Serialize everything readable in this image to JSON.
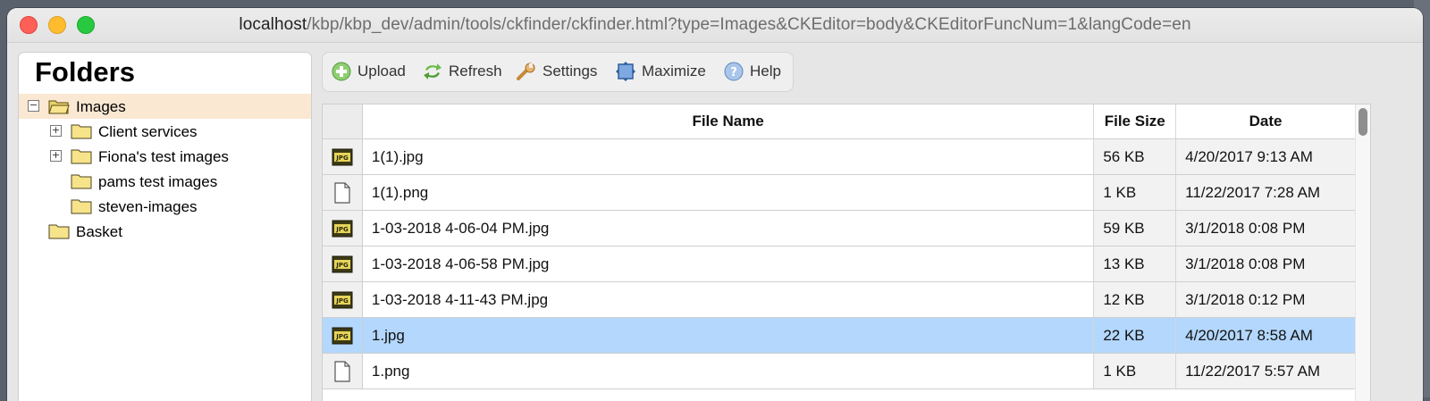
{
  "window": {
    "url_host": "localhost",
    "url_path": "/kbp/kbp_dev/admin/tools/ckfinder/ckfinder.html?type=Images&CKEditor=body&CKEditorFuncNum=1&langCode=en"
  },
  "folders": {
    "title": "Folders",
    "tree": [
      {
        "label": "Images",
        "toggle": "−",
        "selected": true
      },
      {
        "label": "Client services",
        "toggle": "+"
      },
      {
        "label": "Fiona's test images",
        "toggle": "+"
      },
      {
        "label": "pams test images",
        "toggle": ""
      },
      {
        "label": "steven-images",
        "toggle": ""
      },
      {
        "label": "Basket",
        "toggle": ""
      }
    ]
  },
  "toolbar": {
    "upload_label": "Upload",
    "refresh_label": "Refresh",
    "settings_label": "Settings",
    "maximize_label": "Maximize",
    "help_label": "Help"
  },
  "table": {
    "headers": {
      "name": "File Name",
      "size": "File Size",
      "date": "Date"
    },
    "rows": [
      {
        "name": "1(1).jpg",
        "size": "56 KB",
        "date": "4/20/2017 9:13 AM",
        "type": "jpg"
      },
      {
        "name": "1(1).png",
        "size": "1 KB",
        "date": "11/22/2017 7:28 AM",
        "type": "png"
      },
      {
        "name": "1-03-2018 4-06-04 PM.jpg",
        "size": "59 KB",
        "date": "3/1/2018 0:08 PM",
        "type": "jpg"
      },
      {
        "name": "1-03-2018 4-06-58 PM.jpg",
        "size": "13 KB",
        "date": "3/1/2018 0:08 PM",
        "type": "jpg"
      },
      {
        "name": "1-03-2018 4-11-43 PM.jpg",
        "size": "12 KB",
        "date": "3/1/2018 0:12 PM",
        "type": "jpg"
      },
      {
        "name": "1.jpg",
        "size": "22 KB",
        "date": "4/20/2017 8:58 AM",
        "type": "jpg",
        "selected": true
      },
      {
        "name": "1.png",
        "size": "1 KB",
        "date": "11/22/2017 5:57 AM",
        "type": "png"
      }
    ]
  },
  "colors": {
    "selected_row": "#b3d7fd",
    "selected_folder": "#fae8d3",
    "close": "#fe5f57",
    "minimize": "#febc2e",
    "maximize": "#28c840"
  }
}
